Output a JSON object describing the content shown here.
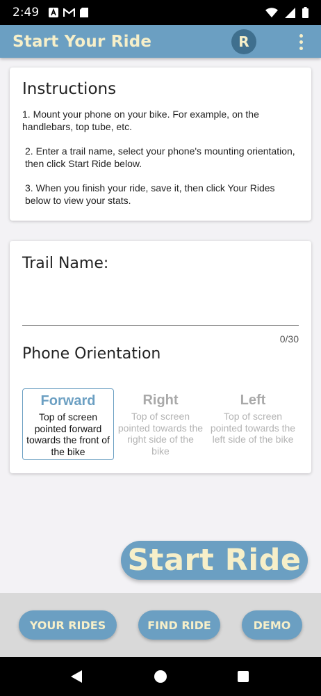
{
  "status_bar": {
    "time": "2:49",
    "icons_left": [
      "a-notification-icon",
      "gmail-icon",
      "sd-card-icon"
    ],
    "icons_right": [
      "wifi-icon",
      "signal-icon",
      "battery-icon"
    ]
  },
  "app_bar": {
    "title": "Start Your Ride",
    "avatar_letter": "R"
  },
  "instructions": {
    "heading": "Instructions",
    "items": [
      "1. Mount your phone on your bike. For example, on the handlebars, top tube, etc.",
      "2. Enter a trail name, select your phone's mounting orientation, then click Start Ride below.",
      "3. When you finish your ride, save it, then click Your Rides below to view your stats."
    ]
  },
  "trail": {
    "label": "Trail Name:",
    "value": "",
    "counter": "0/30",
    "orientation_heading": "Phone Orientation",
    "options": [
      {
        "title": "Forward",
        "desc": "Top of screen pointed forward towards the front of the bike"
      },
      {
        "title": "Right",
        "desc": "Top of screen pointed towards the right side of the bike"
      },
      {
        "title": "Left",
        "desc": "Top of screen pointed towards the left side of the bike"
      }
    ]
  },
  "start_button": "Start Ride",
  "bottom_nav": {
    "your_rides": "YOUR  RIDES",
    "find_ride": "FIND RIDE",
    "demo": "DEMO"
  },
  "colors": {
    "accent": "#6b9fc2",
    "accent_text": "#f6efc9",
    "avatar_bg": "#3f6f8e"
  }
}
